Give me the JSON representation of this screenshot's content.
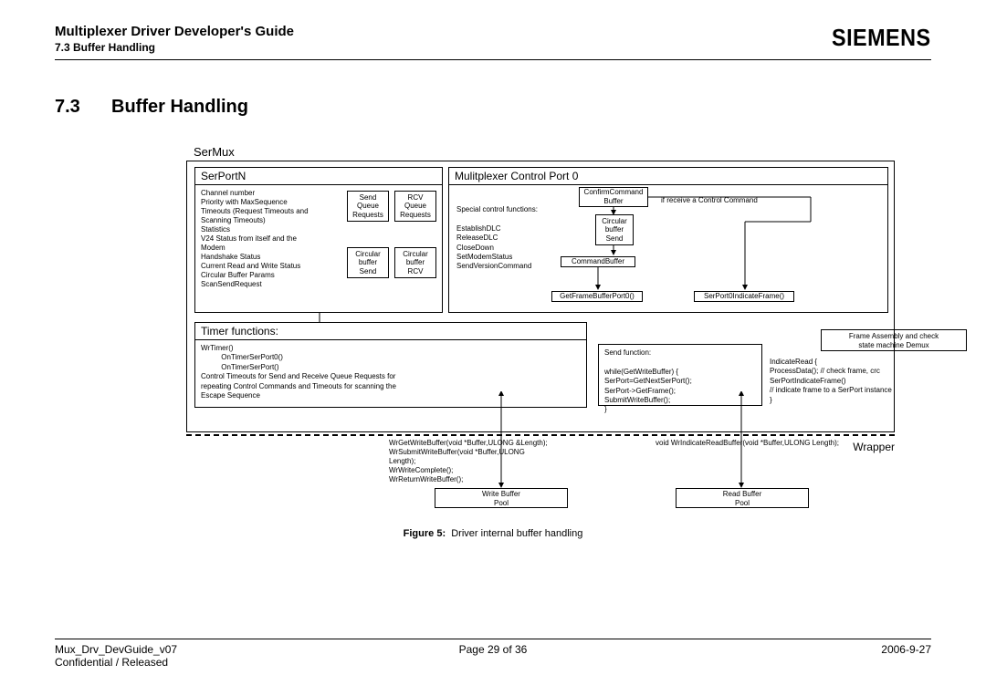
{
  "header": {
    "doc_title": "Multiplexer Driver Developer's Guide",
    "sub_title": "7.3 Buffer Handling",
    "logo": "SIEMENS"
  },
  "section": {
    "number": "7.3",
    "title": "Buffer Handling"
  },
  "diagram": {
    "sermux_label": "SerMux",
    "serportn": {
      "title": "SerPortN",
      "text": "Channel number\nPriority with MaxSequence\nTimeouts (Request Timeouts and\nScanning Timeouts)\nStatistics\nV24 Status from itself and the\nModem\nHandshake Status\nCurrent Read and Write Status\nCircular Buffer Params\nScanSendRequest",
      "sb1": "Send\nQueue\nRequests",
      "sb2": "RCV\nQueue\nRequests",
      "sb3": "Circular\nbuffer\nSend",
      "sb4": "Circular\nbuffer\nRCV"
    },
    "timer": {
      "title": "Timer functions:",
      "text": "WrTimer()\n          OnTimerSerPort0()\n          OnTimerSerPort()\nControl Timeouts for Send and Receive Queue Requests for\nrepeating Control Commands and Timeouts for scanning the\nEscape Sequence"
    },
    "mux": {
      "title": "Mulitplexer Control Port 0",
      "left_text": "Special control functions:\n\nEstablishDLC\nReleaseDLC\nCloseDown\nSetModemStatus\nSendVersionCommand",
      "confirm_box": "ConfirmCommand\nBuffer",
      "circ_send": "Circular\nbuffer\nSend",
      "cmd_buf": "CommandBuffer",
      "getframe": "GetFrameBufferPort0()",
      "indicate": "SerPort0IndicateFrame()",
      "receive_text": "if receive a Control Command"
    },
    "send_func": "Send function:\n\nwhile(GetWriteBuffer)  {\nSerPort=GetNextSerPort();\nSerPort->GetFrame();\nSubmitWriteBuffer();\n}",
    "frame_asm": "Frame Assembly and check\nstate machine Demux",
    "indicate_read": "IndicateRead {\nProcessData(); // check frame, crc\nSerPortIndicateFrame()\n// indicate frame to a SerPort instance\n}",
    "wrapper_label": "Wrapper",
    "wrapper_left": "WrGetWriteBuffer(void *Buffer,ULONG &Length);\nWrSubmitWriteBuffer(void *Buffer,ULONG\nLength);\nWrWriteComplete();\nWrReturnWriteBuffer();",
    "wrapper_right": "void WrIndicateReadBuffer(void *Buffer,ULONG Length);",
    "write_pool": "Write Buffer\nPool",
    "read_pool": "Read Buffer\nPool"
  },
  "figure": {
    "label": "Figure 5:",
    "caption": "Driver internal buffer handling"
  },
  "footer": {
    "doc_id": "Mux_Drv_DevGuide_v07",
    "confidential": "Confidential / Released",
    "page": "Page 29 of 36",
    "date": "2006-9-27"
  }
}
